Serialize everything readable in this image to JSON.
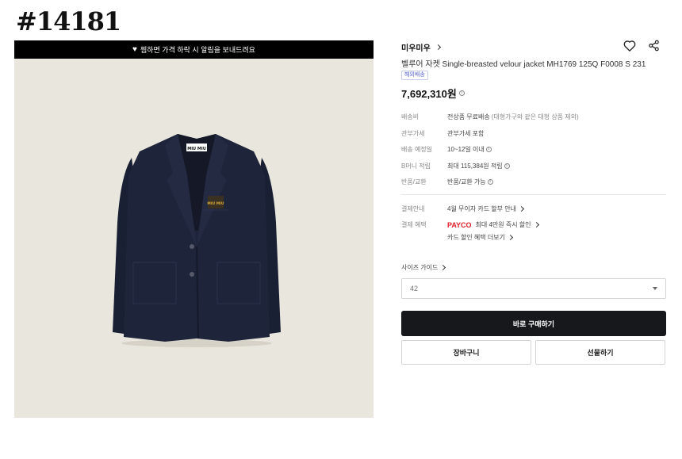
{
  "page_id": "#14181",
  "image": {
    "wish_banner": "찜하면 가격 하락 시 알림을 보내드려요",
    "jacket_label": "MIU MIU",
    "patch_text": "MIU MIU"
  },
  "product": {
    "brand": "미우미우",
    "name": "벨루어 자켓 Single-breasted velour jacket MH1769 125Q F0008 S 231",
    "tag": "해외배송",
    "price": "7,692,310원"
  },
  "details": [
    {
      "label": "배송비",
      "value": "전상품 무료배송",
      "note": "(대형가구와 같은 대형 상품 제외)",
      "info": false
    },
    {
      "label": "관부가세",
      "value": "관부가세 포함",
      "note": "",
      "info": false
    },
    {
      "label": "배송 예정일",
      "value": "10~12일 이내",
      "note": "",
      "info": true
    },
    {
      "label": "B머니 적립",
      "value": "최대 115,384원 적립",
      "note": "",
      "info": true
    },
    {
      "label": "반품/교환",
      "value": "반품/교환 가능",
      "note": "",
      "info": true
    }
  ],
  "payment": {
    "guide_label": "결제안내",
    "guide_value": "4월 무이자 카드 할부 안내",
    "benefit_label": "결제 혜택",
    "payco_brand": "PAYCO",
    "payco_text": "최대 4만원 즉시 할인",
    "card_discount": "카드 할인 혜택 더보기"
  },
  "size": {
    "guide": "사이즈 가이드",
    "selected": "42"
  },
  "buttons": {
    "buy": "바로 구매하기",
    "cart": "장바구니",
    "gift": "선물하기"
  },
  "colors": {
    "jacket": "#1c2237",
    "payco": "#e01e29",
    "buy_button": "#17181c",
    "image_bg": "#e9e6dd"
  }
}
